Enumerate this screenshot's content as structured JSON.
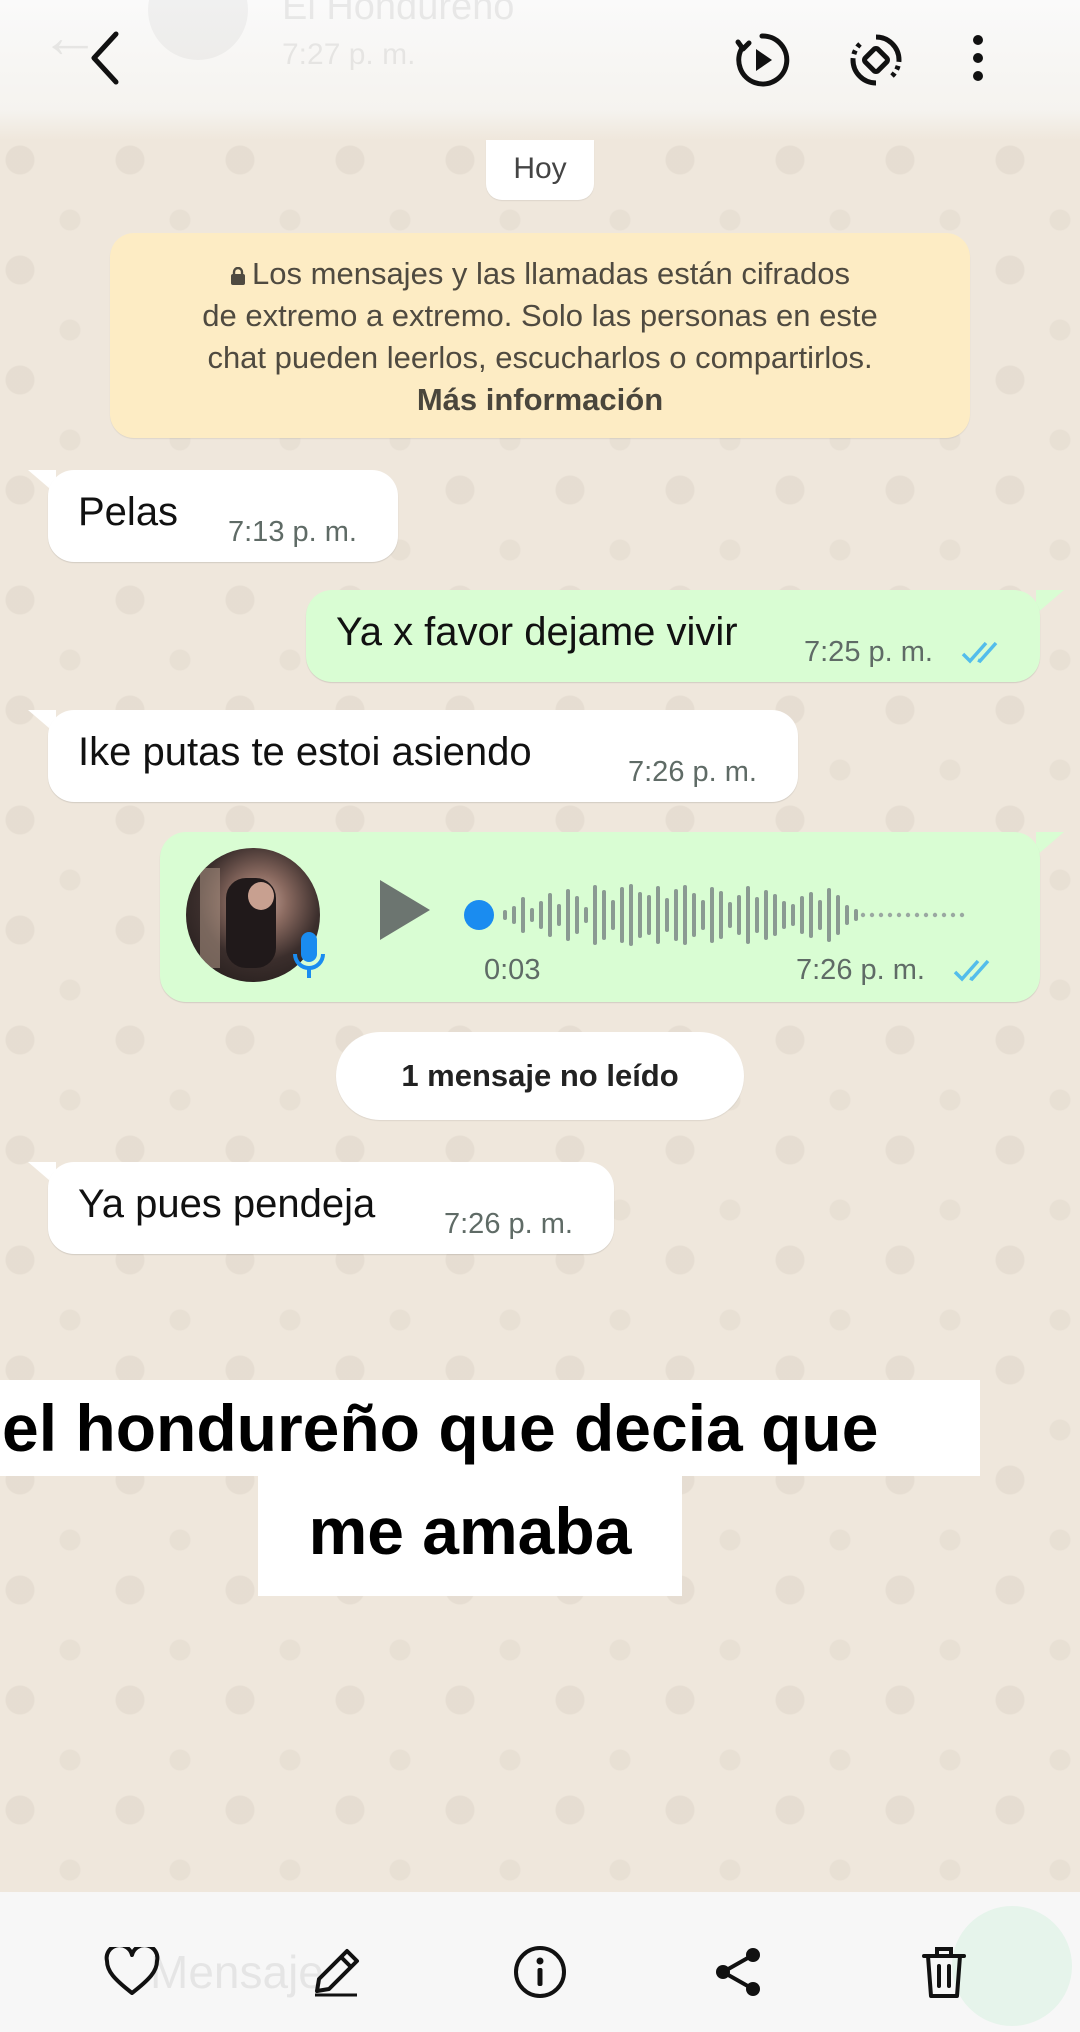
{
  "header": {
    "contact_name": "El Hondureño",
    "last_seen": "7:27 p. m."
  },
  "date_chip": "Hoy",
  "encryption_notice": {
    "text_lines": [
      "Los mensajes y las llamadas están cifrados",
      "de extremo a extremo. Solo las personas en este",
      "chat pueden leerlos, escucharlos o compartirlos."
    ],
    "link": "Más información"
  },
  "messages": [
    {
      "text": "Pelas",
      "time": "7:13 p. m."
    },
    {
      "text": "Ya x favor dejame vivir",
      "time": "7:25 p. m."
    },
    {
      "text": "Ike putas te estoi asiendo",
      "time": "7:26 p. m."
    },
    {
      "voice_duration": "0:03",
      "time": "7:26 p. m.",
      "progress": 0
    },
    {
      "text": "Ya pues pendeja",
      "time": "7:26 p. m."
    }
  ],
  "unread_chip": "1 mensaje no leído",
  "caption": {
    "line1": "el hondureño que decia que",
    "line2": "me amaba"
  },
  "composer_placeholder": "Mensaje",
  "colors": {
    "outgoing_bubble": "#d9fdd3",
    "incoming_bubble": "#ffffff",
    "read_ticks": "#53bdeb",
    "voice_dot": "#1a8cf0",
    "notice_bg": "#fdecc4"
  },
  "icons": {
    "top": [
      "back-arrow-icon",
      "video-play-icon",
      "sync-icon",
      "more-vert-icon"
    ],
    "bottom": [
      "heart-icon",
      "pencil-icon",
      "info-icon",
      "share-icon",
      "trash-icon"
    ]
  }
}
